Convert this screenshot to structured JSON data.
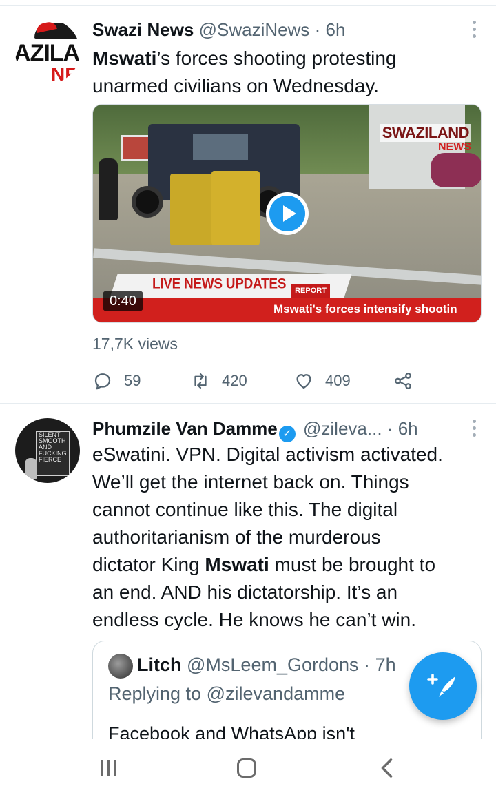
{
  "tweets": [
    {
      "author_name": "Swazi News",
      "handle": "@SwaziNews",
      "separator": "·",
      "time": "6h",
      "avatar_text": {
        "line1": "AZILA",
        "line2": "NF"
      },
      "text": "Mswati’s forces shooting protesting unarmed civilians on Wednesday.",
      "text_parts": {
        "highlight": "Mswati",
        "rest_line1": "’s forces shooting protesting",
        "line2": "unarmed civilians on Wednesday."
      },
      "media": {
        "type": "video",
        "duration": "0:40",
        "logo_line1": "SWAZILAND",
        "logo_line2": "NEWS",
        "banner": "LIVE NEWS UPDATES",
        "tag": "REPORT",
        "ticker": "Mswati's forces intensify shootin"
      },
      "views": "17,7K views",
      "stats": {
        "replies": "59",
        "retweets": "420",
        "likes": "409"
      }
    },
    {
      "author_name": "Phumzile Van Damme",
      "verified": true,
      "verified_glyph": "✓",
      "handle": "@zileva...",
      "separator": "·",
      "time": "6h",
      "avatar_text": {
        "l1": "SILENT",
        "l2": "SMOOTH",
        "l3": "AND",
        "l4": "FUCKING",
        "l5": "FIERCE"
      },
      "text_lines": [
        "eSwatini. VPN. Digital activism activated.",
        "We’ll get the internet back on. Things",
        "cannot continue like this. The digital",
        "authoritarianism of the murderous"
      ],
      "text_line5": {
        "pre": "dictator King ",
        "bold": "Mswati",
        "post": " must be brought to"
      },
      "text_line6": "an end. AND his dictatorship. It’s an",
      "text_line7": "endless cycle. He knows he can’t win.",
      "quoted": {
        "author_name": "Litch",
        "handle": "@MsLeem_Gordons",
        "separator": "·",
        "time": "7h",
        "replying_to_label": "Replying to",
        "replying_to_handle": "@zilevandamme",
        "body_partial": "Facebook and WhatsApp isn't"
      }
    }
  ],
  "compose_button": {
    "icon": "feather-plus-icon"
  },
  "nav": {
    "recent": "recent-apps-icon",
    "home": "home-icon",
    "back": "back-icon"
  },
  "colors": {
    "accent": "#1d9bf0",
    "text": "#0f1419",
    "muted": "#536471",
    "news_red": "#d1201d"
  }
}
